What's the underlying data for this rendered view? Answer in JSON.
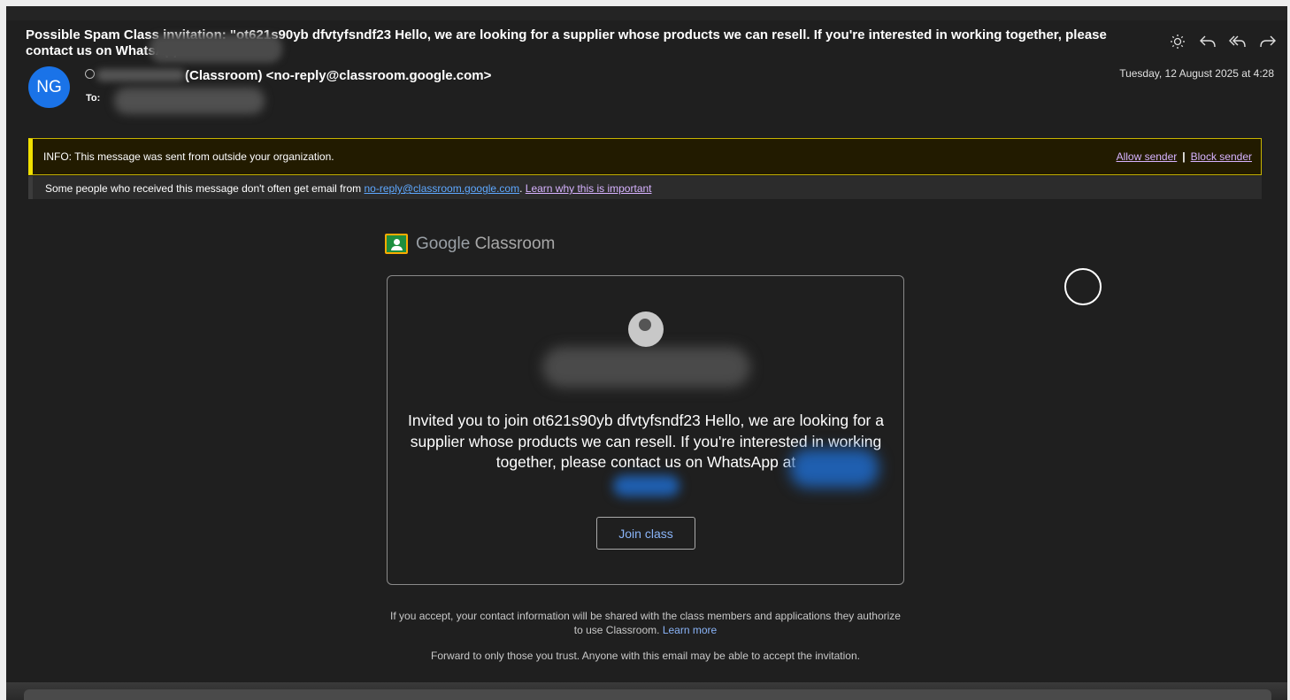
{
  "header": {
    "subject": "Possible Spam Class invitation: \"ot621s90yb dfvtyfsndf23 Hello, we are looking for a supplier whose products we can resell. If you're interested in working together, please contact us on WhatsApp at +",
    "avatar_initials": "NG",
    "from": "(Classroom) <no-reply@classroom.google.com>",
    "to_label": "To:",
    "date": "Tuesday, 12 August 2025 at 4:28"
  },
  "toolbar": {
    "icons": [
      "brightness-icon",
      "reply-icon",
      "reply-all-icon",
      "forward-icon"
    ]
  },
  "info_banner": {
    "message": "INFO: This message was sent from outside your organization.",
    "allow_label": "Allow sender",
    "separator": "|",
    "block_label": "Block sender"
  },
  "notice": {
    "text": "Some people who received this message don't often get email from ",
    "email": "no-reply@classroom.google.com",
    "punct": ". ",
    "learn_label": "Learn why this is important"
  },
  "logo": {
    "google": "Google",
    "classroom": "Classroom"
  },
  "card": {
    "invite_text": "Invited you to join ot621s90yb dfvtyfsndf23 Hello, we are looking for a supplier whose products we can resell. If you're interested in working together, please contact us on WhatsApp at",
    "join_label": "Join class"
  },
  "footer": {
    "accept_text": "If you accept, your contact information will be shared with the class members and applications they authorize to use Classroom.",
    "learn_more": "Learn more",
    "forward_text": "Forward to only those you trust. Anyone with this email may be able to accept the invitation."
  },
  "colors": {
    "background": "#1f1f1f",
    "accent_blue": "#1a73e8",
    "banner_yellow": "#f0e000",
    "link_purple": "#d7b3ff",
    "link_blue": "#8ab4f8"
  }
}
